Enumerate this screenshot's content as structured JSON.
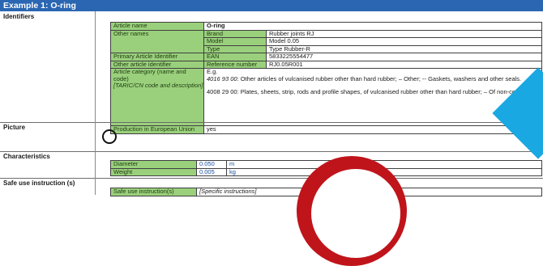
{
  "title": "Example 1: O-ring",
  "sections": {
    "identifiers": "Identifiers",
    "picture": "Picture",
    "characteristics": "Characteristics",
    "safe_use": "Safe use instruction (s)"
  },
  "identifiers": {
    "article_name_label": "Article name",
    "article_name_value": "O-ring",
    "other_names_label": "Other names",
    "brand_label": "Brand",
    "brand_value": "Rubber joints RJ",
    "model_label": "Model",
    "model_value": "Model 0.05",
    "type_label": "Type",
    "type_value": "Type Rubber-R",
    "primary_id_label": "Primary Article Identifier",
    "primary_id_key": "EAN",
    "primary_id_value": "5833225554477",
    "other_id_label": "Other article identifier",
    "other_id_key": "Reference number",
    "other_id_value": "RJ0.05R001",
    "category_label_line1": "Article category (name and",
    "category_label_line2": "code)",
    "category_label_italic": "[TARIC/CN code and description]",
    "category_eg": "E.g.",
    "category_code_1": "4016 93 00",
    "category_text_1": ": Other articles of vulcanised rubber other than hard rubber; – Other; -- Gaskets, washers and other seals.",
    "category_text_2": "4008 29 00: Plates, sheets, strip, rods and profile shapes, of vulcanised rubber other than hard rubber; – Of non-cellular rubber; -- Other",
    "production_label": "Production in European Union",
    "production_value": "yes"
  },
  "characteristics": {
    "diameter_label": "Diameter",
    "diameter_value": "0.050",
    "diameter_unit": "m",
    "weight_label": "Weight",
    "weight_value": "0.005",
    "weight_unit": "kg"
  },
  "safe_use": {
    "label": "Safe use instruction(s)",
    "value": "[Specific instructions]"
  },
  "colors": {
    "title_bar": "#2a66b2",
    "label_cell": "#9ad07c",
    "accent_cyan": "#1aa8e2",
    "accent_red": "#c0141b"
  }
}
